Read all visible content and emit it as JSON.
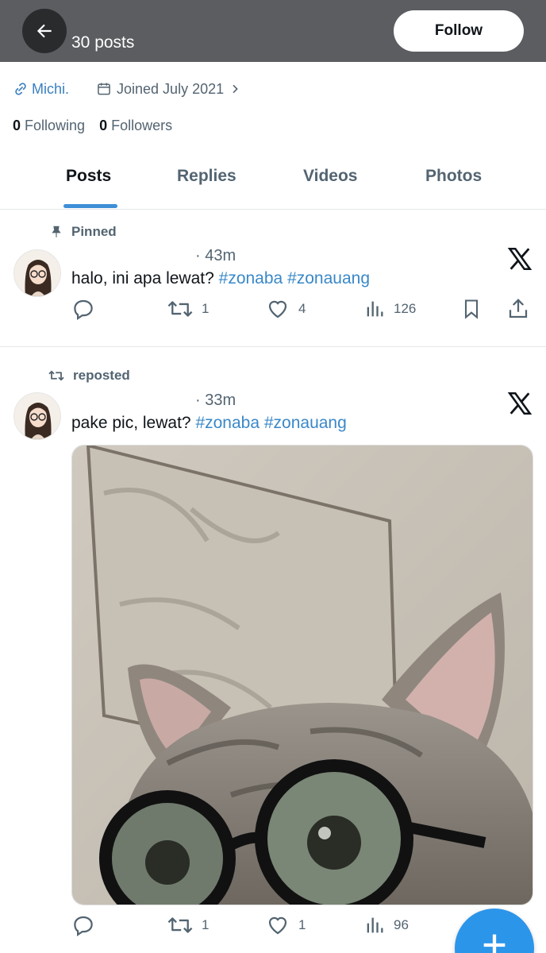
{
  "header": {
    "posts_count": "30 posts",
    "follow_label": "Follow"
  },
  "profile": {
    "link_text": "Michi.",
    "joined_text": "Joined July 2021",
    "following_count": "0",
    "following_label": "Following",
    "followers_count": "0",
    "followers_label": "Followers"
  },
  "tabs": [
    {
      "label": "Posts",
      "active": true
    },
    {
      "label": "Replies",
      "active": false
    },
    {
      "label": "Videos",
      "active": false
    },
    {
      "label": "Photos",
      "active": false
    }
  ],
  "posts": [
    {
      "context": "Pinned",
      "time": "· 43m",
      "text": "halo, ini apa lewat?",
      "hashtags": [
        "#zonaba",
        "#zonauang"
      ],
      "replies": "",
      "reposts": "1",
      "likes": "4",
      "views": "126"
    },
    {
      "context": "reposted",
      "time": "· 33m",
      "text": "pake pic, lewat?",
      "hashtags": [
        "#zonaba",
        "#zonauang"
      ],
      "replies": "",
      "reposts": "1",
      "likes": "1",
      "views": "96"
    }
  ],
  "icons": {
    "back": "arrow-left-icon",
    "link": "link-icon",
    "calendar": "calendar-icon",
    "chevron": "chevron-right-icon",
    "pin": "pin-icon",
    "repost_context": "repost-icon",
    "x_logo": "x-logo-icon",
    "reply": "reply-icon",
    "repost": "repost-icon",
    "like": "heart-icon",
    "views": "views-icon",
    "bookmark": "bookmark-icon",
    "share": "share-icon",
    "compose": "plus-icon"
  },
  "colors": {
    "header_bg": "#5b5d60",
    "accent": "#1d9bf0",
    "hashtag": "#3a88c8",
    "fab": "#2b95e9"
  }
}
